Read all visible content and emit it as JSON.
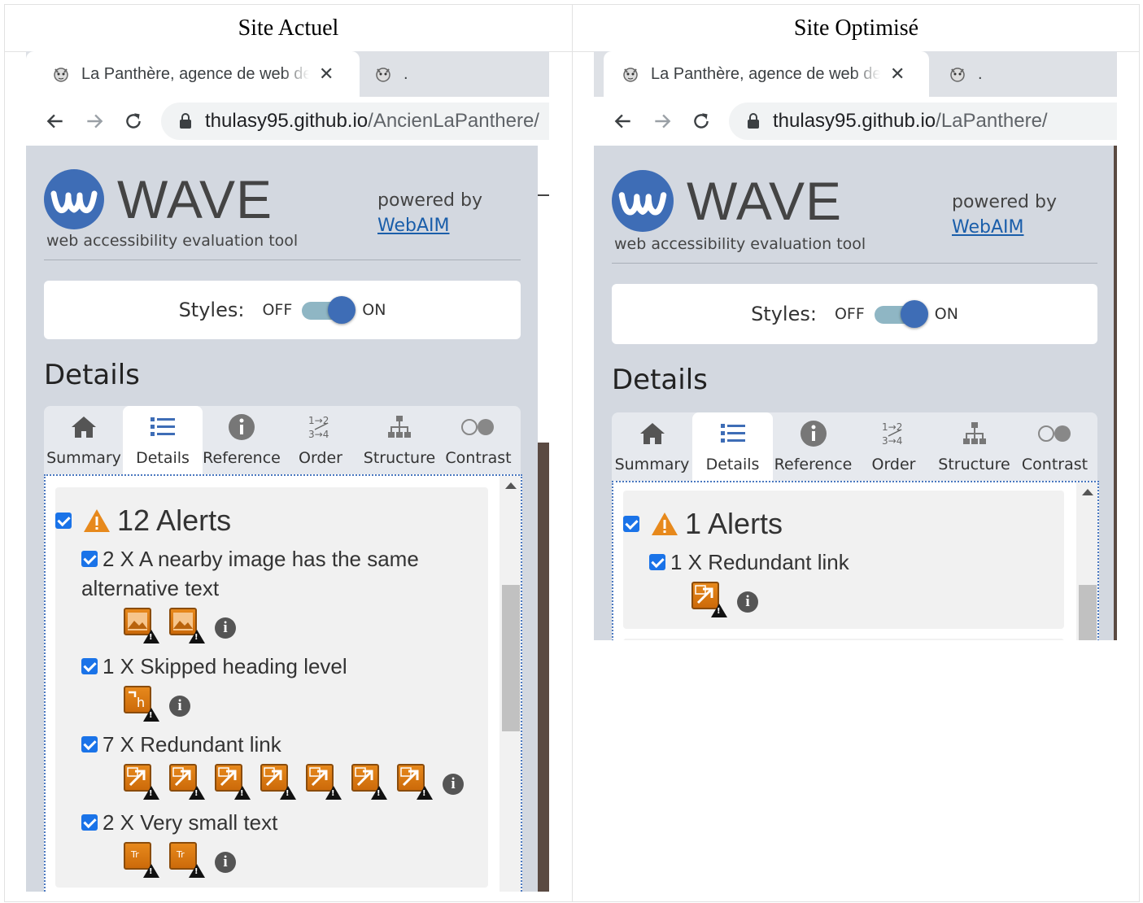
{
  "comparison": {
    "left_heading": "Site Actuel",
    "right_heading": "Site Optimisé"
  },
  "left": {
    "tab_title": "La Panthère, agence de web design",
    "tab_close": "✕",
    "tab2_title": ".",
    "url_host": "thulasy95.github.io",
    "url_path": "/AncienLaPanthere/",
    "wave_word": "WAVE",
    "tagline": "web accessibility evaluation tool",
    "powered_by": "powered by",
    "webaim": "WebAIM",
    "styles_label": "Styles:",
    "off": "OFF",
    "on": "ON",
    "details_title": "Details",
    "tabs": [
      "Summary",
      "Details",
      "Reference",
      "Order",
      "Structure",
      "Contrast"
    ],
    "alerts_title": "12 Alerts",
    "items": [
      {
        "text": "2 X A nearby image has the same alternative text",
        "icon": "alt-same-icon",
        "count": 2
      },
      {
        "text": "1 X Skipped heading level",
        "icon": "heading-skipped-icon",
        "count": 1
      },
      {
        "text": "7 X Redundant link",
        "icon": "redundant-link-icon",
        "count": 7
      },
      {
        "text": "2 X Very small text",
        "icon": "small-text-icon",
        "count": 2
      }
    ]
  },
  "right": {
    "tab_title": "La Panthère, agence de web design",
    "tab_close": "✕",
    "tab2_title": ".",
    "url_host": "thulasy95.github.io",
    "url_path": "/LaPanthere/",
    "wave_word": "WAVE",
    "tagline": "web accessibility evaluation tool",
    "powered_by": "powered by",
    "webaim": "WebAIM",
    "styles_label": "Styles:",
    "off": "OFF",
    "on": "ON",
    "details_title": "Details",
    "tabs": [
      "Summary",
      "Details",
      "Reference",
      "Order",
      "Structure",
      "Contrast"
    ],
    "alerts_title": "1 Alerts",
    "items": [
      {
        "text": "1 X Redundant link",
        "icon": "redundant-link-icon",
        "count": 1
      }
    ]
  },
  "colors": {
    "wave_bg": "#d3d8e0",
    "wave_blue": "#3e6db6",
    "alert_orange": "#e7891c",
    "checkbox_blue": "#1a73e8",
    "tab_bar": "#dee1e6"
  }
}
